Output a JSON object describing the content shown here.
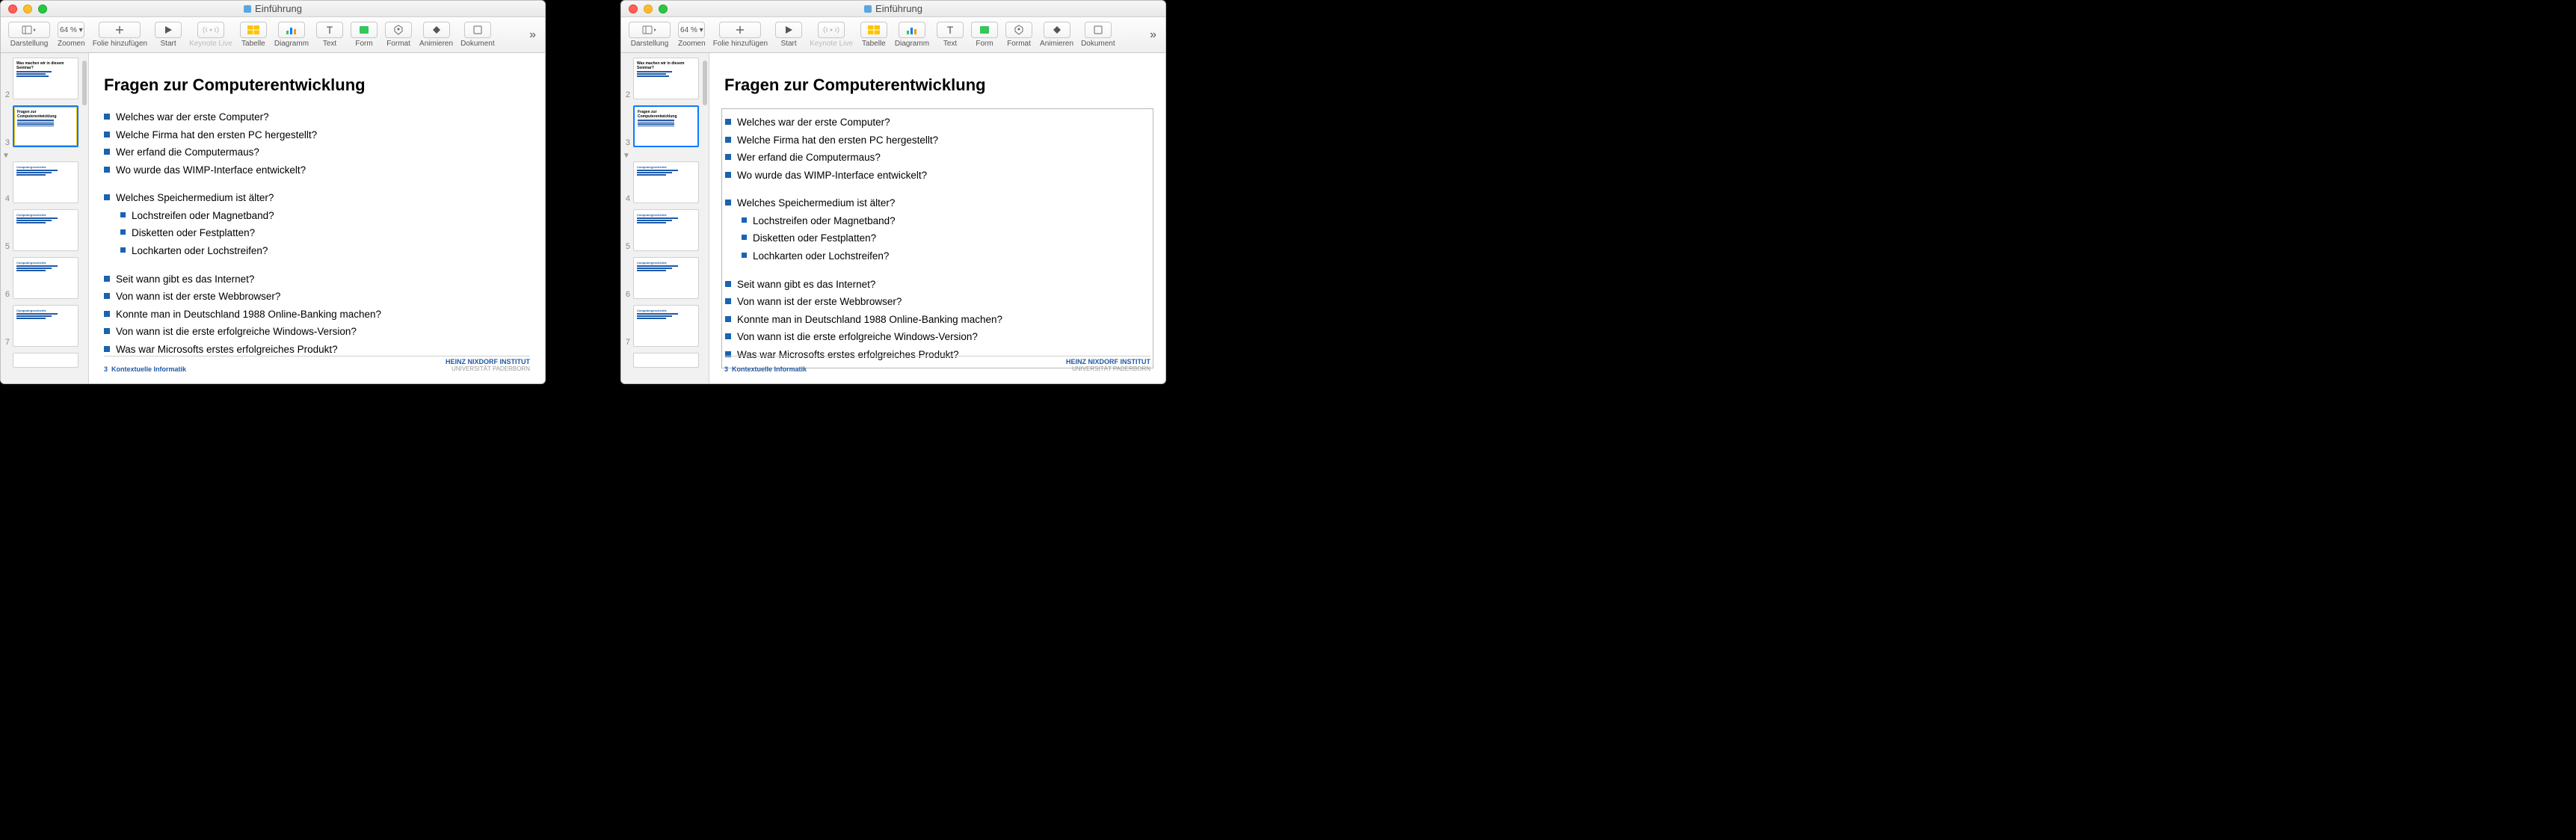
{
  "window": {
    "title": "Einführung"
  },
  "toolbar": {
    "view": "Darstellung",
    "zoom": "Zoomen",
    "zoom_val": "64 %",
    "add": "Folie hinzufügen",
    "play": "Start",
    "live": "Keynote Live",
    "table": "Tabelle",
    "chart": "Diagramm",
    "text": "Text",
    "shape": "Form",
    "format": "Format",
    "animate": "Animieren",
    "document": "Dokument"
  },
  "thumbs": [
    "2",
    "3",
    "4",
    "5",
    "6",
    "7"
  ],
  "slide": {
    "title": "Fragen zur Computerentwicklung",
    "g1": [
      "Welches war der erste Computer?",
      "Welche Firma hat den ersten PC hergestellt?",
      "Wer erfand die Computermaus?",
      "Wo wurde das WIMP-Interface entwickelt?"
    ],
    "g2": {
      "head": "Welches Speichermedium ist älter?",
      "subs": [
        "Lochstreifen oder Magnetband?",
        "Disketten oder Festplatten?",
        "Lochkarten oder Lochstreifen?"
      ]
    },
    "g3": [
      "Seit wann gibt es das Internet?",
      "Von wann ist der erste Webbrowser?",
      "Konnte man in Deutschland 1988 Online-Banking machen?",
      "Von wann ist die erste erfolgreiche Windows-Version?",
      "Was war Microsofts erstes erfolgreiches Produkt?"
    ],
    "page": "3",
    "footer_title": "Kontextuelle Informatik",
    "institute": "HEINZ NIXDORF INSTITUT",
    "university": "UNIVERSITÄT PADERBORN"
  }
}
